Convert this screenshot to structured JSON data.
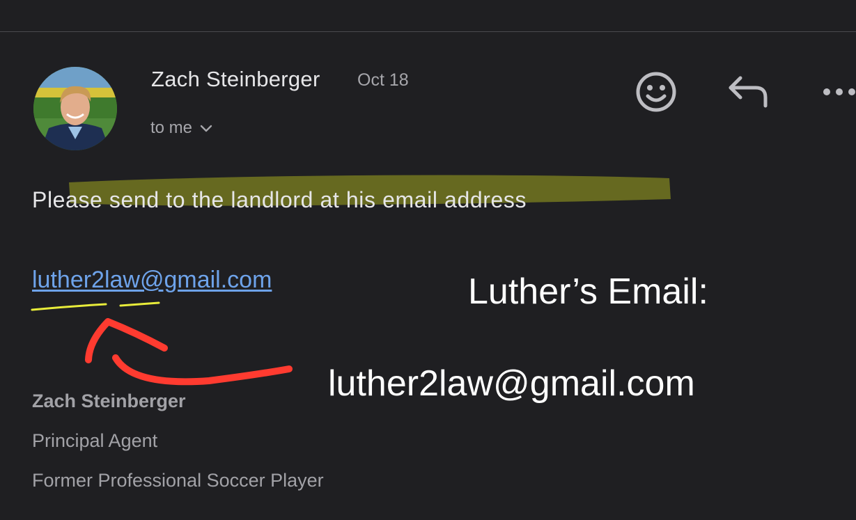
{
  "message": {
    "sender_name": "Zach Steinberger",
    "date": "Oct 18",
    "recipient": "to me",
    "body": "Please send to the landlord at his email address",
    "email_link": "luther2law@gmail.com"
  },
  "actions": {
    "emoji_icon": "smiley-face-icon",
    "reply_icon": "reply-arrow-icon",
    "more_icon": "more-dots-icon"
  },
  "annotation": {
    "heading": "Luther’s Email:",
    "email": "luther2law@gmail.com",
    "highlight_color": "#e8ec3a",
    "arrow_color": "#ff3b30"
  },
  "signature": {
    "name": "Zach Steinberger",
    "title": "Principal Agent",
    "tagline": "Former Professional Soccer Player"
  },
  "colors": {
    "background": "#1f1f22",
    "link": "#6ea3ea",
    "text": "#e6e6e8",
    "muted": "#a6a6ab"
  }
}
